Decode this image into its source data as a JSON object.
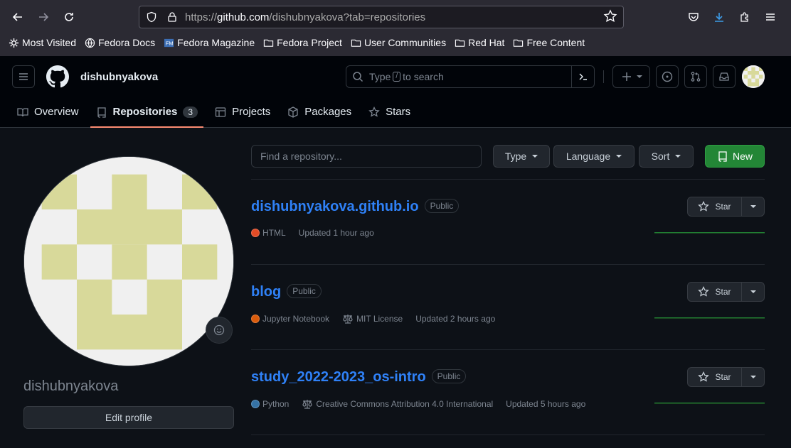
{
  "browser": {
    "url_prefix": "https://",
    "url_host": "github.com",
    "url_path": "/dishubnyakova?tab=repositories",
    "bookmarks": [
      "Most Visited",
      "Fedora Docs",
      "Fedora Magazine",
      "Fedora Project",
      "User Communities",
      "Red Hat",
      "Free Content"
    ]
  },
  "header": {
    "username": "dishubnyakova",
    "search_prefix": "Type",
    "search_key": "/",
    "search_suffix": "to search"
  },
  "tabs": [
    {
      "label": "Overview"
    },
    {
      "label": "Repositories",
      "count": "3"
    },
    {
      "label": "Projects"
    },
    {
      "label": "Packages"
    },
    {
      "label": "Stars"
    }
  ],
  "profile": {
    "name": "dishubnyakova",
    "edit_label": "Edit profile",
    "avatar_color": "#d8d99a"
  },
  "filters": {
    "find_placeholder": "Find a repository...",
    "type_label": "Type",
    "language_label": "Language",
    "sort_label": "Sort",
    "new_label": "New"
  },
  "repos": [
    {
      "name": "dishubnyakova.github.io",
      "visibility": "Public",
      "language": "HTML",
      "language_color": "#e34c26",
      "license": "",
      "updated": "Updated 1 hour ago",
      "star_label": "Star"
    },
    {
      "name": "blog",
      "visibility": "Public",
      "language": "Jupyter Notebook",
      "language_color": "#da5b0b",
      "license": "MIT License",
      "updated": "Updated 2 hours ago",
      "star_label": "Star"
    },
    {
      "name": "study_2022-2023_os-intro",
      "visibility": "Public",
      "language": "Python",
      "language_color": "#3572a5",
      "license": "Creative Commons Attribution 4.0 International",
      "updated": "Updated 5 hours ago",
      "star_label": "Star"
    }
  ]
}
